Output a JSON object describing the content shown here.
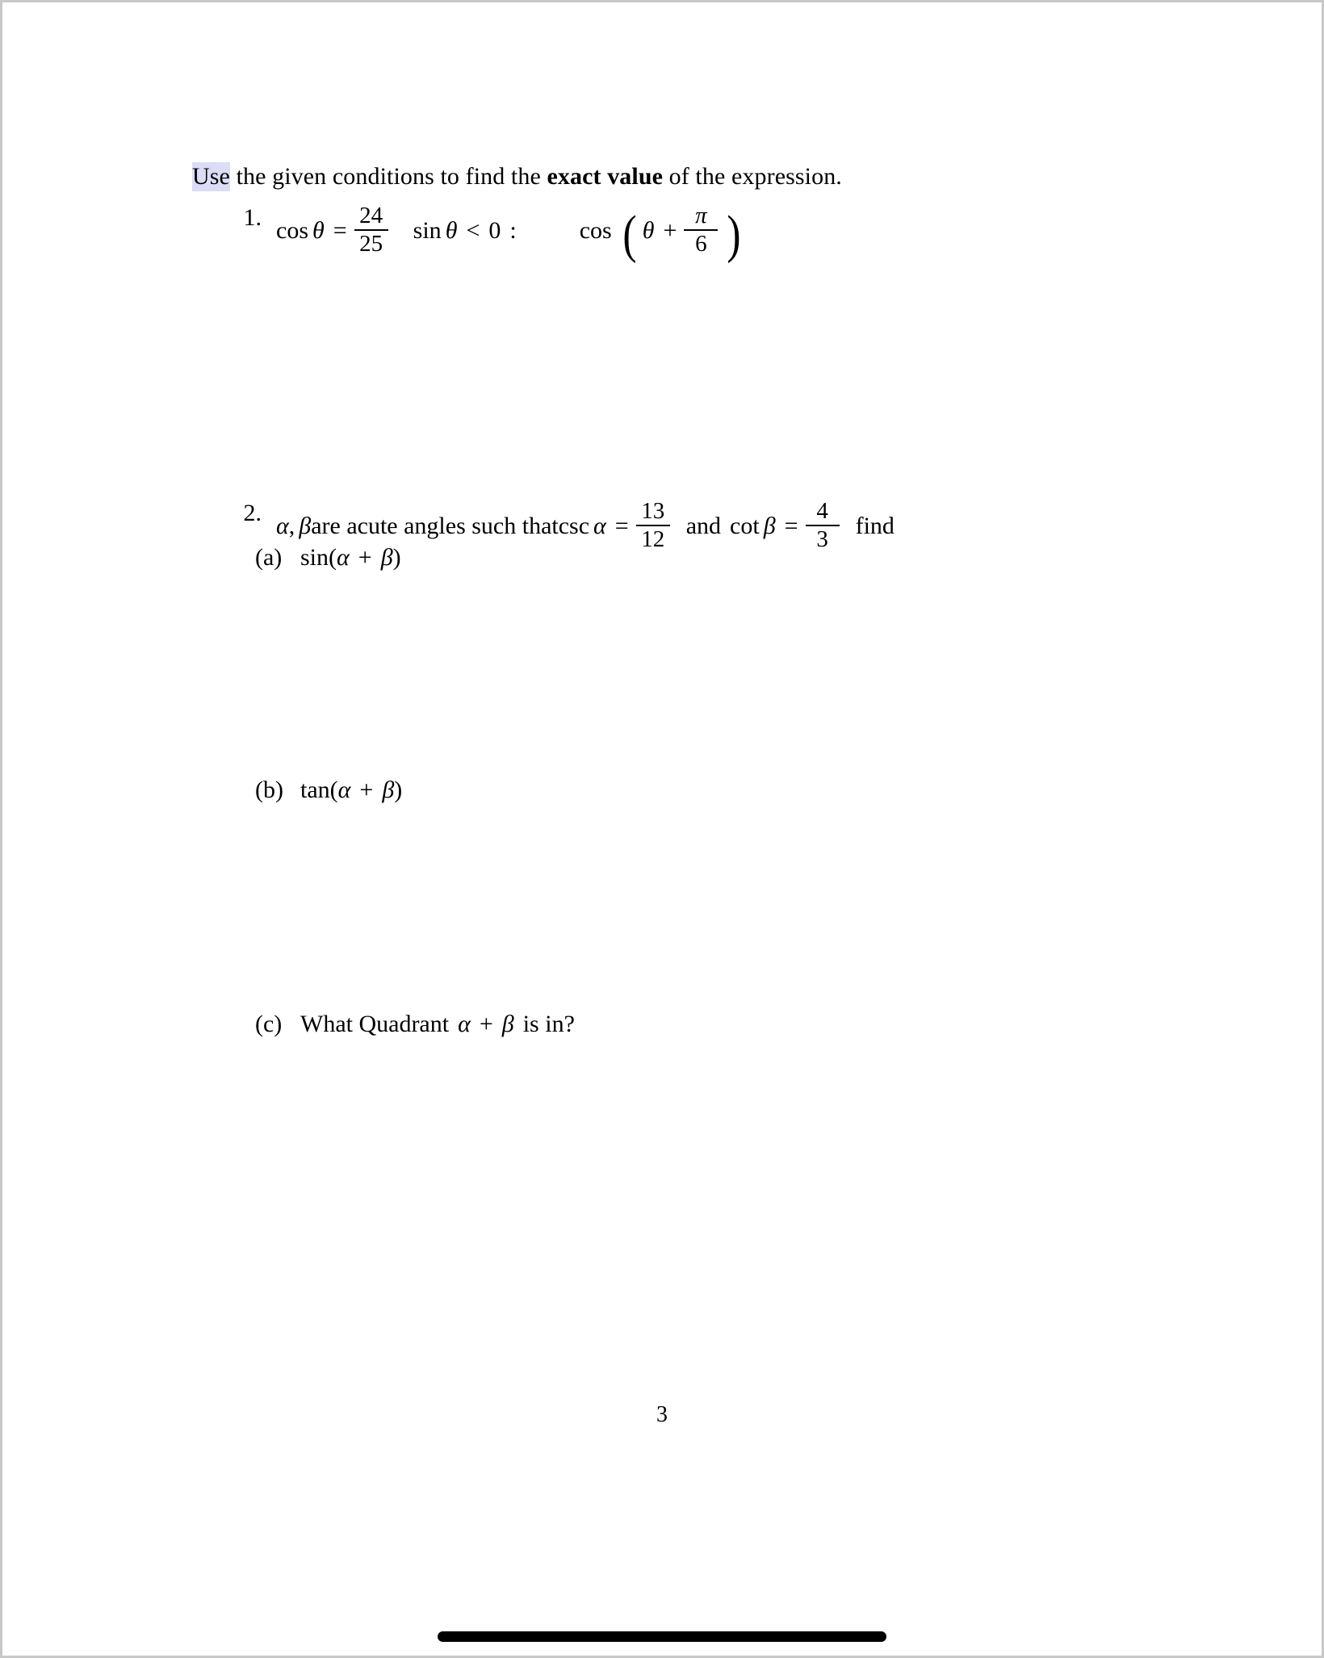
{
  "document": {
    "page_number": "3",
    "highlight_color": "#dcdcf6",
    "intro": {
      "highlighted_word": "Use",
      "text_before_bold": " the given conditions to find the ",
      "bold_text": "exact value",
      "text_after_bold": " of the expression."
    },
    "problems": [
      {
        "number": "1.",
        "given": {
          "function": "cos",
          "variable": "θ",
          "equals": "=",
          "value_numerator": "24",
          "value_denominator": "25"
        },
        "condition": {
          "function": "sin",
          "variable": "θ",
          "relation": "<",
          "value": "0",
          "colon": ":"
        },
        "expression": {
          "function": "cos",
          "open_paren": "(",
          "variable": "θ",
          "plus": "+",
          "numerator": "π",
          "denominator": "6",
          "close_paren": ")"
        }
      },
      {
        "number": "2.",
        "statement": {
          "alpha": "α",
          "comma": ",",
          "beta": "β",
          "text_1": " are acute angles such that ",
          "csc_label": "csc",
          "csc_arg": "α",
          "csc_equals": "=",
          "csc_numerator": "13",
          "csc_denominator": "12",
          "text_2": "and",
          "cot_label": "cot",
          "cot_arg": "β",
          "cot_equals": "=",
          "cot_numerator": "4",
          "cot_denominator": "3",
          "text_3": "find"
        },
        "subparts": [
          {
            "label": "(a)",
            "function": "sin",
            "open_paren": "(",
            "arg_1": "α",
            "plus": "+",
            "arg_2": "β",
            "close_paren": ")"
          },
          {
            "label": "(b)",
            "function": "tan",
            "open_paren": "(",
            "arg_1": "α",
            "plus": "+",
            "arg_2": "β",
            "close_paren": ")"
          },
          {
            "label": "(c)",
            "text_before": "What Quadrant",
            "arg_1": "α",
            "plus": "+",
            "arg_2": "β",
            "text_after": "is in?"
          }
        ]
      }
    ]
  },
  "system_ui": {
    "home_indicator": "home-indicator-bar"
  }
}
